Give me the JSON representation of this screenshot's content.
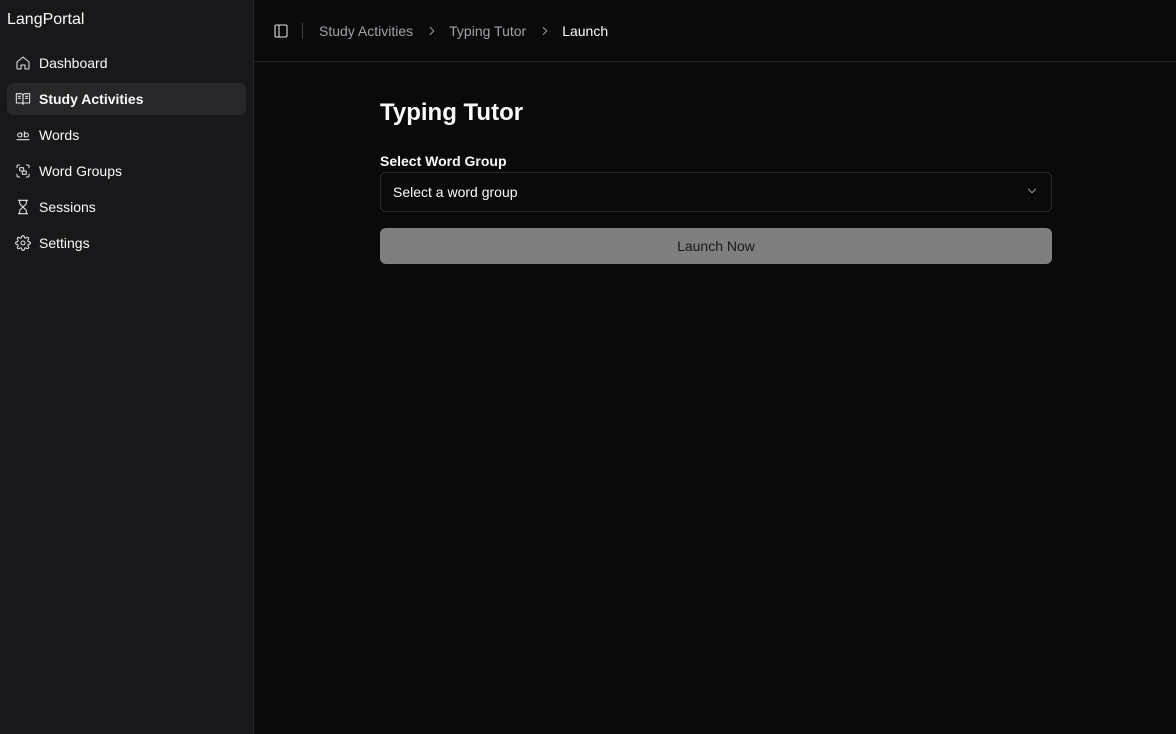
{
  "app": {
    "brand": "LangPortal"
  },
  "sidebar": {
    "items": [
      {
        "label": "Dashboard",
        "icon": "home-icon",
        "active": false
      },
      {
        "label": "Study Activities",
        "icon": "book-open-icon",
        "active": true
      },
      {
        "label": "Words",
        "icon": "whole-word-icon",
        "active": false
      },
      {
        "label": "Word Groups",
        "icon": "group-scan-icon",
        "active": false
      },
      {
        "label": "Sessions",
        "icon": "hourglass-icon",
        "active": false
      },
      {
        "label": "Settings",
        "icon": "gear-icon",
        "active": false
      }
    ]
  },
  "topbar": {
    "toggle_icon": "panel-left-icon",
    "breadcrumb": [
      {
        "label": "Study Activities"
      },
      {
        "label": "Typing Tutor"
      },
      {
        "label": "Launch"
      }
    ]
  },
  "main": {
    "title": "Typing Tutor",
    "word_group_label": "Select Word Group",
    "word_group_select": {
      "placeholder": "Select a word group",
      "icon": "chevron-down-icon"
    },
    "launch_label": "Launch Now"
  },
  "colors": {
    "sidebar_bg": "#18181b",
    "main_bg": "#0a0a0b",
    "active_item_bg": "#27272a",
    "launch_button_bg": "#7f7f7f"
  }
}
